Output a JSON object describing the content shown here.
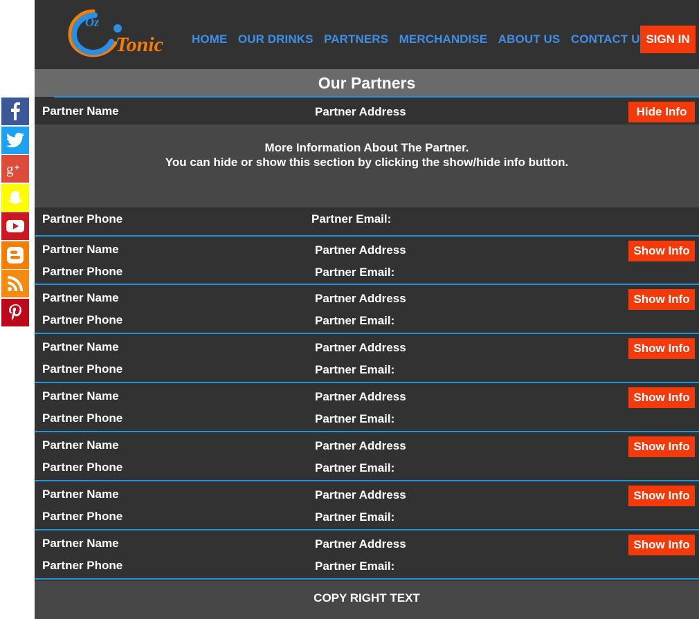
{
  "brand": {
    "logo_top": "Oz",
    "logo_main": "Tonic"
  },
  "nav": {
    "items": [
      "HOME",
      "OUR DRINKS",
      "PARTNERS",
      "MERCHANDISE",
      "ABOUT US",
      "CONTACT US"
    ],
    "signin_label": "SIGN IN"
  },
  "page_title": "Our Partners",
  "expanded_partner": {
    "name": "Partner Name",
    "address": "Partner Address",
    "button_label": "Hide Info",
    "info_line1": "More Information About The Partner.",
    "info_line2": "You can hide or show this section by clicking the show/hide info button.",
    "phone": "Partner Phone",
    "email": "Partner Email:"
  },
  "partners": [
    {
      "name": "Partner Name",
      "address": "Partner Address",
      "phone": "Partner Phone",
      "email": "Partner Email:",
      "button_label": "Show Info"
    },
    {
      "name": "Partner Name",
      "address": "Partner Address",
      "phone": "Partner Phone",
      "email": "Partner Email:",
      "button_label": "Show Info"
    },
    {
      "name": "Partner Name",
      "address": "Partner Address",
      "phone": "Partner Phone",
      "email": "Partner Email:",
      "button_label": "Show Info"
    },
    {
      "name": "Partner Name",
      "address": "Partner Address",
      "phone": "Partner Phone",
      "email": "Partner Email:",
      "button_label": "Show Info"
    },
    {
      "name": "Partner Name",
      "address": "Partner Address",
      "phone": "Partner Phone",
      "email": "Partner Email:",
      "button_label": "Show Info"
    },
    {
      "name": "Partner Name",
      "address": "Partner Address",
      "phone": "Partner Phone",
      "email": "Partner Email:",
      "button_label": "Show Info"
    },
    {
      "name": "Partner Name",
      "address": "Partner Address",
      "phone": "Partner Phone",
      "email": "Partner Email:",
      "button_label": "Show Info"
    }
  ],
  "footer": {
    "text": "COPY RIGHT TEXT"
  },
  "social": [
    {
      "name": "facebook-icon",
      "color": "#3b5998"
    },
    {
      "name": "twitter-icon",
      "color": "#1da1f2"
    },
    {
      "name": "google-plus-icon",
      "color": "#dd4b39"
    },
    {
      "name": "snapchat-icon",
      "color": "#fffc00"
    },
    {
      "name": "youtube-icon",
      "color": "#cc181e"
    },
    {
      "name": "blogger-icon",
      "color": "#f57d00"
    },
    {
      "name": "rss-icon",
      "color": "#f48a12"
    },
    {
      "name": "pinterest-icon",
      "color": "#bd081c"
    }
  ],
  "colors": {
    "accent": "#f43a0b",
    "nav_link": "#3d8fe8",
    "divider": "#2196d6",
    "panel": "#323232"
  }
}
